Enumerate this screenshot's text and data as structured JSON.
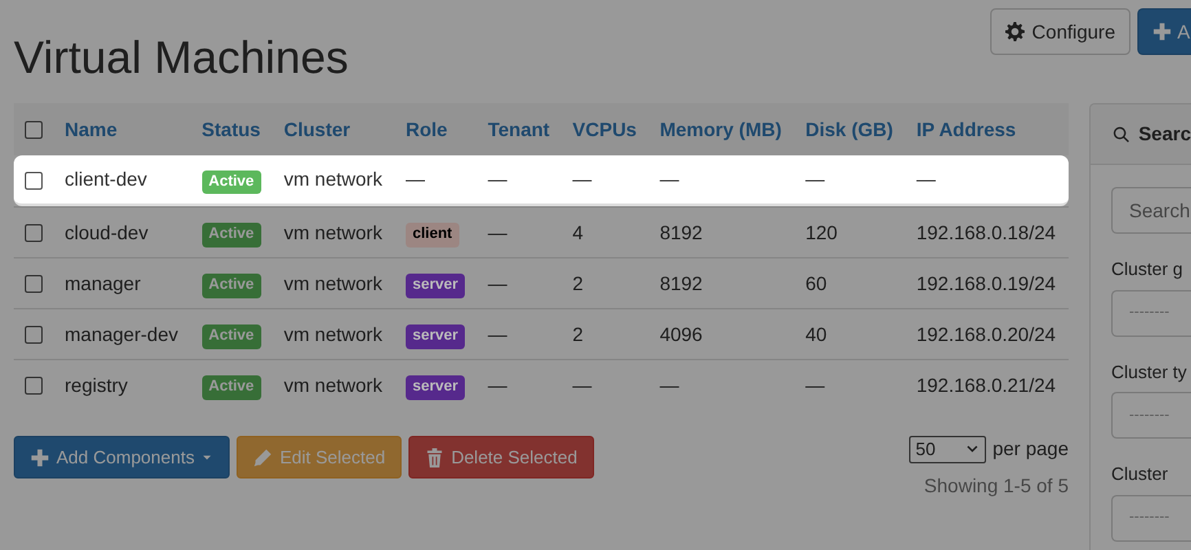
{
  "header": {
    "title": "Virtual Machines",
    "buttons": [
      {
        "kind": "configure",
        "label": "Configure"
      },
      {
        "kind": "add",
        "label": "A"
      }
    ]
  },
  "table": {
    "select_all": {
      "checked": false
    },
    "columns": [
      "Name",
      "Status",
      "Cluster",
      "Role",
      "Tenant",
      "VCPUs",
      "Memory (MB)",
      "Disk (GB)",
      "IP Address"
    ],
    "rows": [
      {
        "highlighted": true,
        "checked": false,
        "name": "client-dev",
        "status": "Active",
        "cluster": "vm network",
        "role": "—",
        "tenant": "—",
        "vcpus": "—",
        "memory": "—",
        "disk": "—",
        "ip": "—"
      },
      {
        "highlighted": false,
        "checked": false,
        "name": "cloud-dev",
        "status": "Active",
        "cluster": "vm network",
        "role": {
          "label": "client",
          "color": "#9c8682"
        },
        "tenant": "—",
        "vcpus": "4",
        "memory": "8192",
        "disk": "120",
        "ip": "192.168.0.18/24"
      },
      {
        "highlighted": false,
        "checked": false,
        "name": "manager",
        "status": "Active",
        "cluster": "vm network",
        "role": {
          "label": "server",
          "color": "#56298c"
        },
        "tenant": "—",
        "vcpus": "2",
        "memory": "8192",
        "disk": "60",
        "ip": "192.168.0.19/24"
      },
      {
        "highlighted": false,
        "checked": false,
        "name": "manager-dev",
        "status": "Active",
        "cluster": "vm network",
        "role": {
          "label": "server",
          "color": "#56298c"
        },
        "tenant": "—",
        "vcpus": "2",
        "memory": "4096",
        "disk": "40",
        "ip": "192.168.0.20/24"
      },
      {
        "highlighted": false,
        "checked": false,
        "name": "registry",
        "status": "Active",
        "cluster": "vm network",
        "role": {
          "label": "server",
          "color": "#56298c"
        },
        "tenant": "—",
        "vcpus": "—",
        "memory": "—",
        "disk": "—",
        "ip": "192.168.0.21/24"
      }
    ]
  },
  "actions": [
    {
      "kind": "add",
      "label": "Add Components"
    },
    {
      "kind": "edit",
      "label": "Edit Selected"
    },
    {
      "kind": "delete",
      "label": "Delete Selected"
    }
  ],
  "pagination": {
    "per_page": "50",
    "per_page_label": "per page",
    "summary": "Showing 1-5 of 5"
  },
  "sidebar": {
    "title": "Searc",
    "search": {
      "placeholder": "Search"
    },
    "filters": [
      {
        "label": "Cluster g",
        "value": "--------"
      },
      {
        "label": "Cluster ty",
        "value": "--------"
      },
      {
        "label": "Cluster",
        "value": "--------"
      }
    ]
  }
}
